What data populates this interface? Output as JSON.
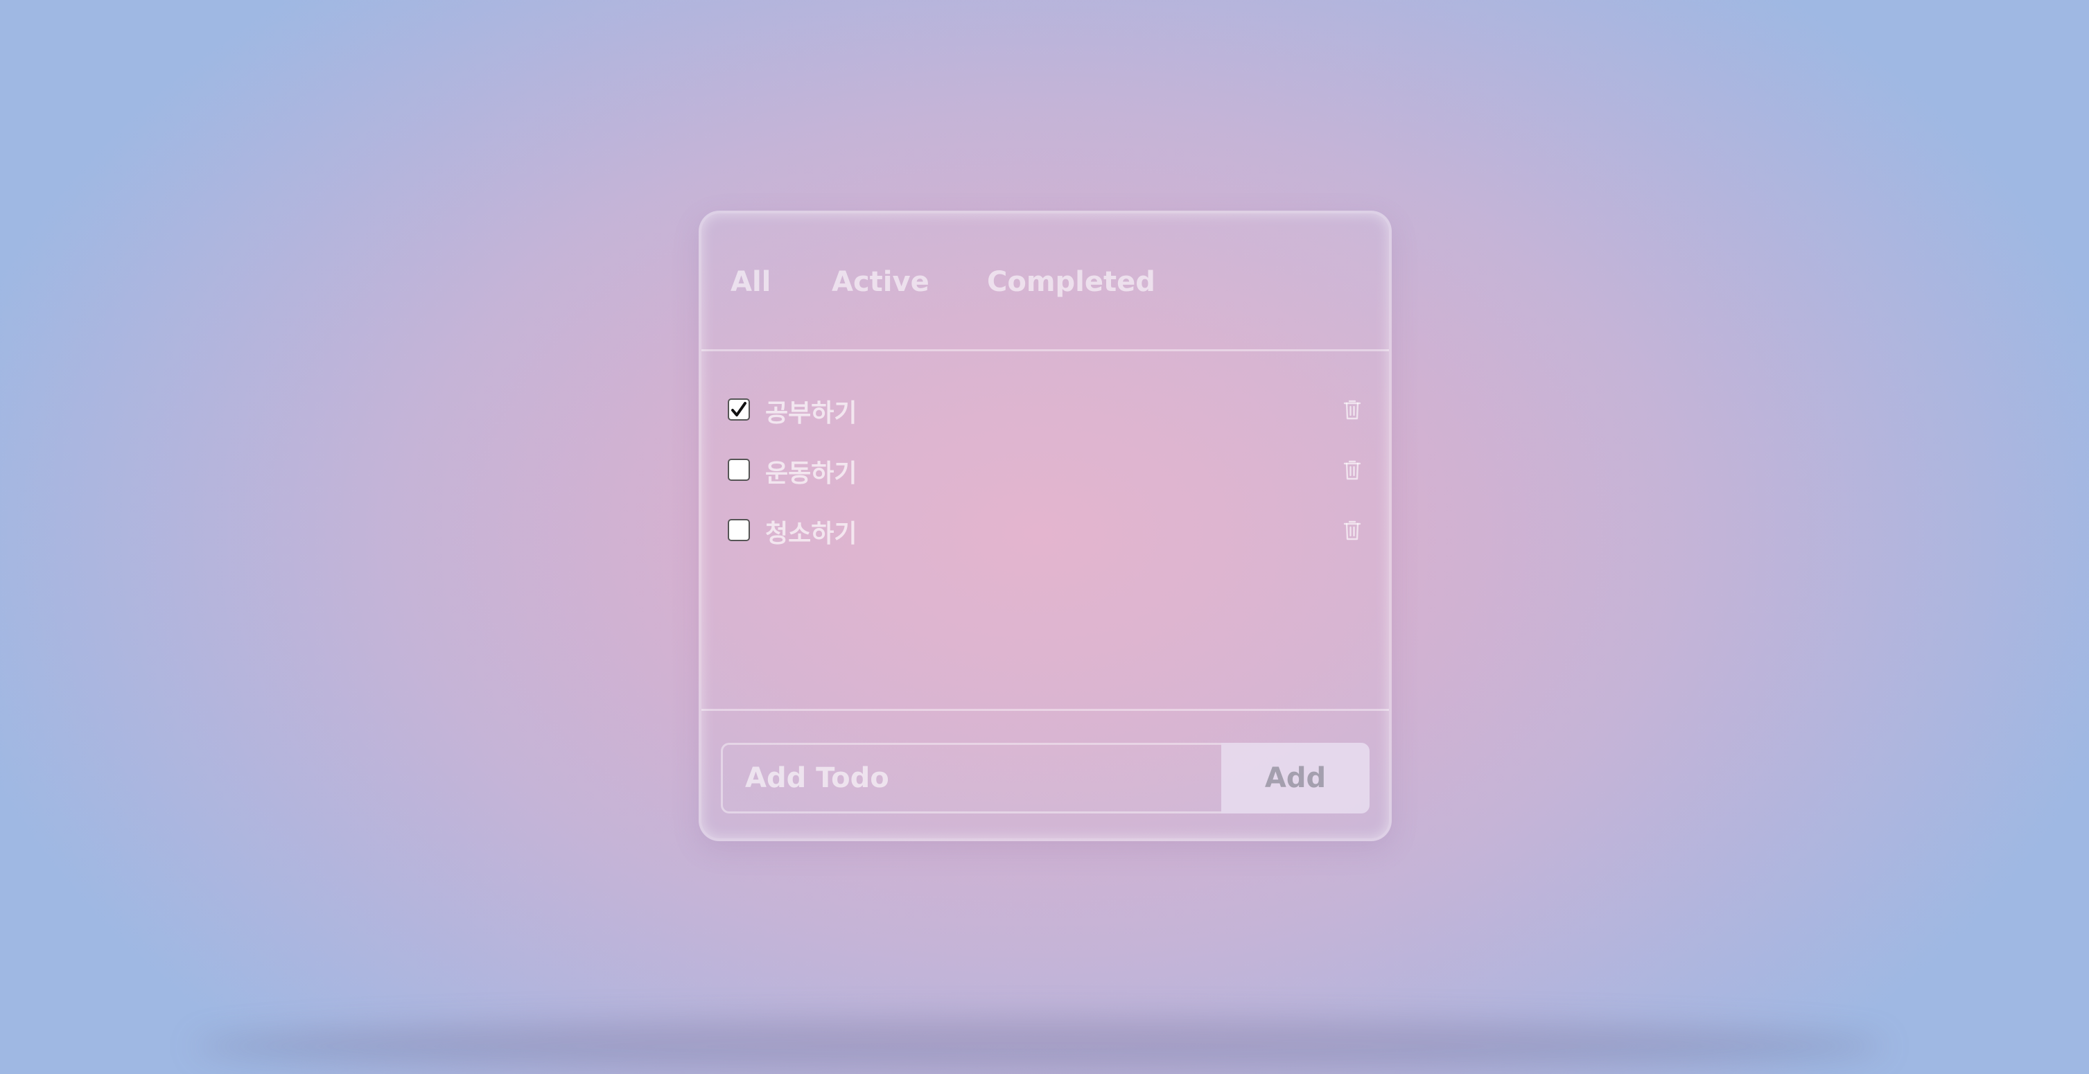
{
  "tabs": [
    {
      "label": "All"
    },
    {
      "label": "Active"
    },
    {
      "label": "Completed"
    }
  ],
  "todos": [
    {
      "text": "공부하기",
      "checked": true
    },
    {
      "text": "운동하기",
      "checked": false
    },
    {
      "text": "청소하기",
      "checked": false
    }
  ],
  "add_form": {
    "placeholder": "Add Todo",
    "button_label": "Add"
  },
  "icons": {
    "checkbox_checked": "check-icon",
    "delete": "trash-icon"
  }
}
